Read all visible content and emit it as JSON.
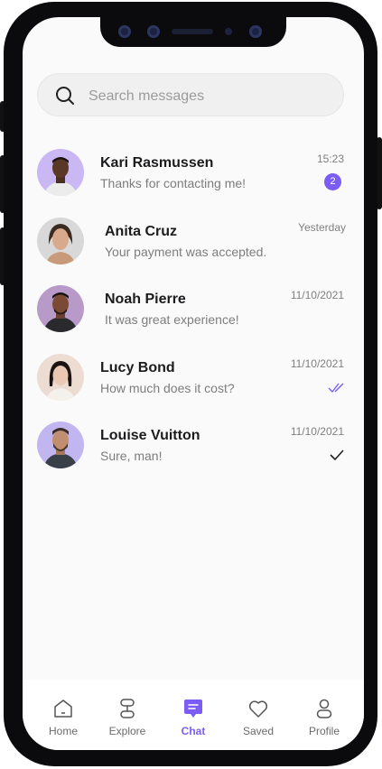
{
  "search": {
    "placeholder": "Search messages"
  },
  "chats": [
    {
      "name": "Kari Rasmussen",
      "preview": "Thanks for contacting me!",
      "time": "15:23",
      "unread": "2",
      "status": "unread"
    },
    {
      "name": "Anita Cruz",
      "preview": "Your payment was accepted.",
      "time": "Yesterday",
      "status": "none"
    },
    {
      "name": "Noah Pierre",
      "preview": "It was great experience!",
      "time": "11/10/2021",
      "status": "none"
    },
    {
      "name": "Lucy Bond",
      "preview": "How much does it cost?",
      "time": "11/10/2021",
      "status": "read-double-check"
    },
    {
      "name": "Louise Vuitton",
      "preview": "Sure, man!",
      "time": "11/10/2021",
      "status": "sent-check"
    }
  ],
  "tabs": [
    {
      "label": "Home",
      "icon": "home-icon"
    },
    {
      "label": "Explore",
      "icon": "explore-icon"
    },
    {
      "label": "Chat",
      "icon": "chat-icon",
      "active": true
    },
    {
      "label": "Saved",
      "icon": "heart-icon"
    },
    {
      "label": "Profile",
      "icon": "profile-icon"
    }
  ],
  "colors": {
    "accent": "#7b5cf5",
    "text": "#1c1c1e",
    "muted": "#7d7d7d"
  }
}
